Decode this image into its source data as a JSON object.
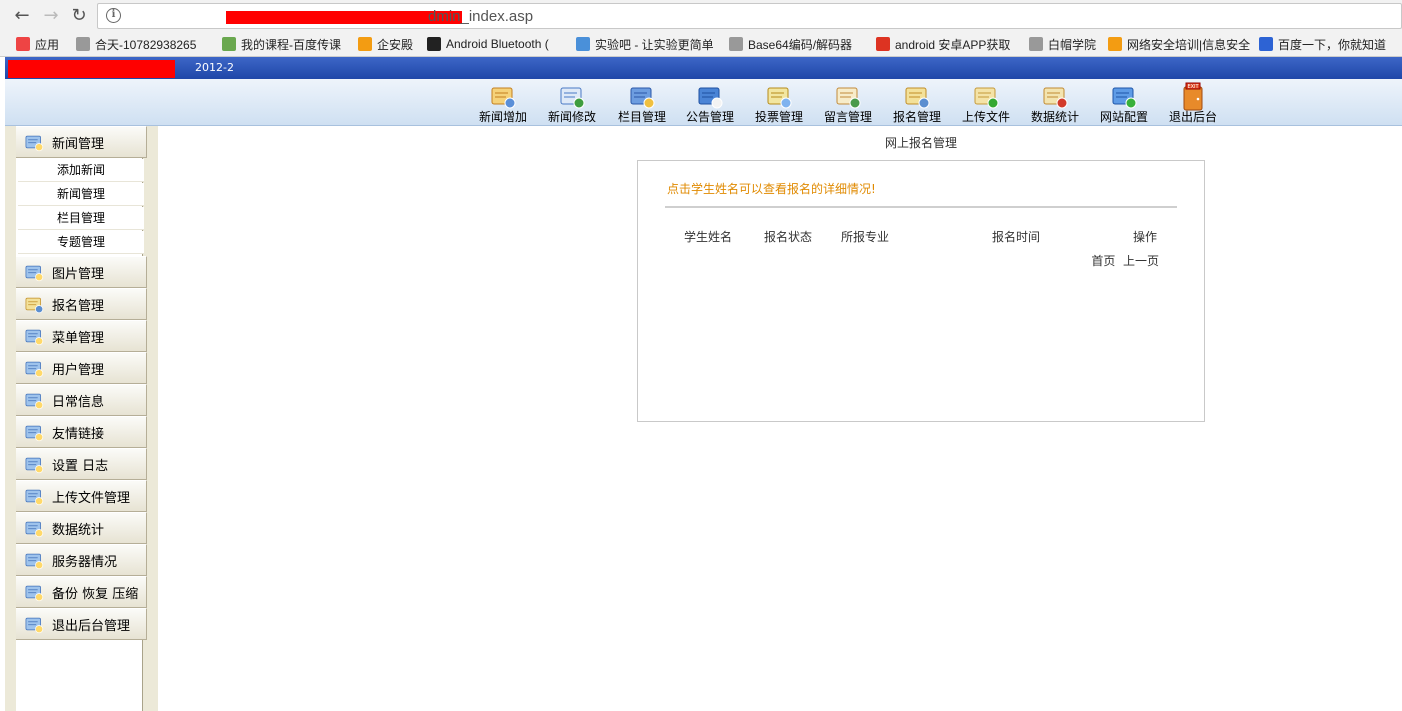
{
  "browser": {
    "url_visible": "dmin_index.asp",
    "bookmarks": [
      {
        "label": "应用",
        "icon": "apps-grid-icon",
        "color": "#e44"
      },
      {
        "label": "合天-10782938265",
        "icon": "page-icon",
        "color": "#999"
      },
      {
        "label": "我的课程-百度传课",
        "icon": "ke-icon",
        "color": "#6aa84f"
      },
      {
        "label": "企安殿",
        "icon": "shield-icon",
        "color": "#f39c12"
      },
      {
        "label": "Android Bluetooth (",
        "icon": "b-icon",
        "color": "#222"
      },
      {
        "label": "实验吧 - 让实验更简单",
        "icon": "lab-icon",
        "color": "#4a90d9"
      },
      {
        "label": "Base64编码/解码器",
        "icon": "page-icon",
        "color": "#999"
      },
      {
        "label": "android 安卓APP获取",
        "icon": "c-icon",
        "color": "#d32"
      },
      {
        "label": "白帽学院",
        "icon": "page-icon",
        "color": "#999"
      },
      {
        "label": "网络安全培训|信息安全",
        "icon": "shield-icon",
        "color": "#f39c12"
      },
      {
        "label": "百度一下，你就知道",
        "icon": "paw-icon",
        "color": "#2d63d4"
      }
    ]
  },
  "header": {
    "version": "2012-2"
  },
  "toolbar": [
    {
      "label": "新闻增加",
      "icon": "news-add-icon"
    },
    {
      "label": "新闻修改",
      "icon": "news-edit-icon"
    },
    {
      "label": "栏目管理",
      "icon": "column-manage-icon"
    },
    {
      "label": "公告管理",
      "icon": "notice-manage-icon"
    },
    {
      "label": "投票管理",
      "icon": "vote-manage-icon"
    },
    {
      "label": "留言管理",
      "icon": "message-manage-icon"
    },
    {
      "label": "报名管理",
      "icon": "signup-manage-icon"
    },
    {
      "label": "上传文件",
      "icon": "upload-file-icon"
    },
    {
      "label": "数据统计",
      "icon": "statistics-icon"
    },
    {
      "label": "网站配置",
      "icon": "site-config-icon"
    },
    {
      "label": "退出后台",
      "icon": "exit-icon"
    }
  ],
  "sidebar": {
    "news_head": {
      "label": "新闻管理",
      "icon": "news-manage-icon"
    },
    "news_sub": [
      "添加新闻",
      "新闻管理",
      "栏目管理",
      "专题管理"
    ],
    "menus": [
      {
        "label": "图片管理",
        "icon": "picture-manage-icon"
      },
      {
        "label": "报名管理",
        "icon": "signup-manage-icon"
      },
      {
        "label": "菜单管理",
        "icon": "menu-manage-icon"
      },
      {
        "label": "用户管理",
        "icon": "user-manage-icon"
      },
      {
        "label": "日常信息",
        "icon": "daily-info-icon"
      },
      {
        "label": "友情链接",
        "icon": "friend-link-icon"
      },
      {
        "label": "设置  日志",
        "icon": "settings-log-icon"
      },
      {
        "label": "上传文件管理",
        "icon": "upload-manage-icon"
      },
      {
        "label": "数据统计",
        "icon": "data-stat-icon"
      },
      {
        "label": "服务器情况",
        "icon": "server-status-icon"
      },
      {
        "label": "备份  恢复  压缩",
        "icon": "backup-icon"
      },
      {
        "label": "退出后台管理",
        "icon": "logout-icon"
      }
    ]
  },
  "main": {
    "title": "网上报名管理",
    "hint": "点击学生姓名可以查看报名的详细情况!",
    "columns": [
      "学生姓名",
      "报名状态",
      "所报专业",
      "报名时间",
      "操作"
    ],
    "pager": {
      "first": "首页",
      "prev": "上一页"
    }
  }
}
